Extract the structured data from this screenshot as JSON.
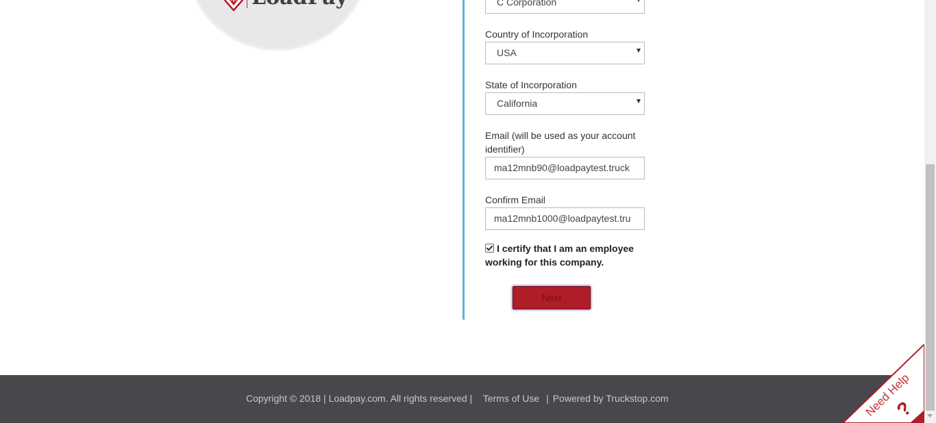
{
  "brand": {
    "logo_text": "LoadPay"
  },
  "form": {
    "company_type_value": "C Corporation",
    "country_label": "Country of Incorporation",
    "country_value": "USA",
    "state_label": "State of Incorporation",
    "state_value": "California",
    "email_label": "Email (will be used as your account identifier)",
    "email_value": "ma12mnb90@loadpaytest.truck",
    "confirm_email_label": "Confirm Email",
    "confirm_email_value": "ma12mnb1000@loadpaytest.tru",
    "certify_text": "I certify that I am an employee working for this company.",
    "certify_checked": true,
    "next_label": "Next"
  },
  "footer": {
    "copyright": "Copyright © 2018 | Loadpay.com. All rights reserved |",
    "terms": "Terms of Use",
    "powered": "Powered by Truckstop.com"
  },
  "help": {
    "label": "Need Help",
    "symbol": "?"
  },
  "colors": {
    "accent_blue": "#5bb0dc",
    "button_red": "#b01c28",
    "footer_bg": "#47484b"
  }
}
